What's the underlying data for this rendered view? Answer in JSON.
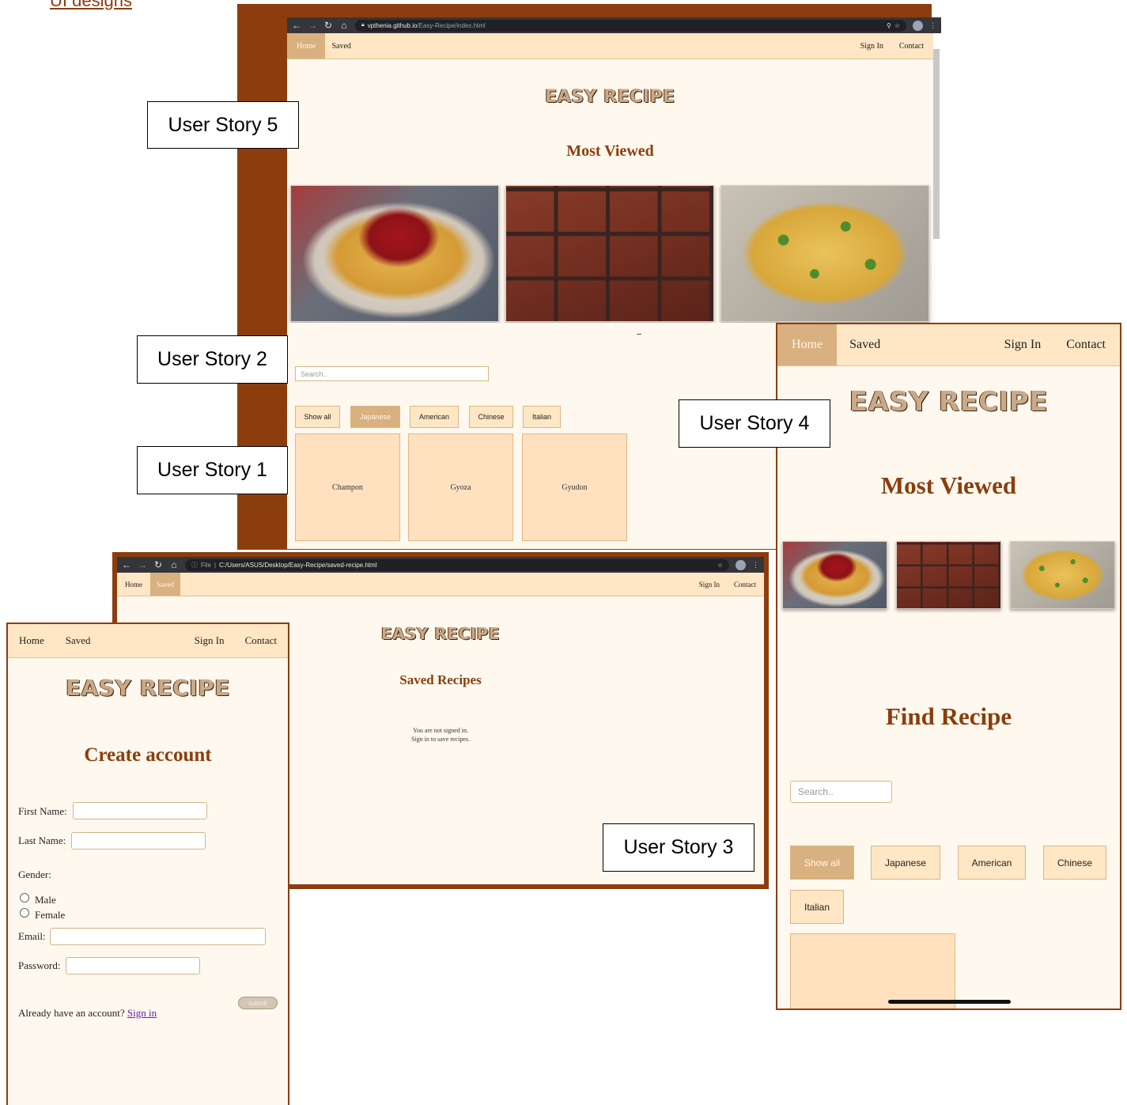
{
  "document": {
    "heading": "UI designs"
  },
  "callouts": {
    "us5": "User Story 5",
    "us2": "User Story 2",
    "us1": "User Story 1",
    "us4": "User Story 4",
    "us3": "User Story 3"
  },
  "home_window": {
    "url_domain": "vpthenia.github.io",
    "url_path": "/Easy-Recipe/index.html",
    "nav": {
      "home": "Home",
      "saved": "Saved",
      "sign_in": "Sign In",
      "contact": "Contact"
    },
    "logo": "EASY RECIPE",
    "most_viewed": "Most Viewed",
    "search_placeholder": "Search..",
    "filters": [
      "Show all",
      "Japanese",
      "American",
      "Chinese",
      "Italian"
    ],
    "active_filter": "Japanese",
    "cards": [
      "Champon",
      "Gyoza",
      "Gyudon"
    ]
  },
  "saved_window": {
    "url_prefix": "File",
    "url_path": "C:/Users/ASUS/Desktop/Easy-Recipe/saved-recipe.html",
    "nav": {
      "home": "Home",
      "saved": "Saved",
      "sign_in": "Sign In",
      "contact": "Contact"
    },
    "logo": "EASY RECIPE",
    "heading": "Saved Recipes",
    "message_line1": "You are not signed in.",
    "message_line2": "Sign in to save recipes."
  },
  "mobile_window": {
    "nav": {
      "home": "Home",
      "saved": "Saved",
      "sign_in": "Sign In",
      "contact": "Contact"
    },
    "logo": "EASY RECIPE",
    "most_viewed": "Most Viewed",
    "find_recipe": "Find Recipe",
    "search_placeholder": "Search..",
    "filters": [
      "Show all",
      "Japanese",
      "American",
      "Chinese",
      "Italian"
    ],
    "active_filter": "Show all"
  },
  "signup_window": {
    "nav": {
      "home": "Home",
      "saved": "Saved",
      "sign_in": "Sign In",
      "contact": "Contact"
    },
    "logo": "EASY RECIPE",
    "heading": "Create account",
    "first_name": "First Name:",
    "last_name": "Last Name:",
    "gender": "Gender:",
    "male": "Male",
    "female": "Female",
    "email": "Email:",
    "password": "Password:",
    "submit": "submit",
    "already": "Already have an account?",
    "sign_in_link": "Sign in"
  },
  "colors": {
    "brown": "#8b3d0d",
    "cream": "#fff8ee",
    "nav_peach": "#ffe6c4",
    "active_tan": "#d9b07f"
  }
}
